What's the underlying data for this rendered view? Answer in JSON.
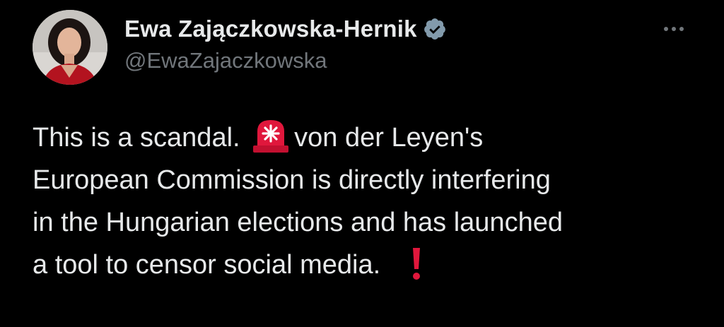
{
  "author": {
    "display_name": "Ewa Zajączkowska-Hernik",
    "handle": "@EwaZajaczkowska",
    "verified": true,
    "avatar_icon": "profile-photo-woman"
  },
  "tweet": {
    "lines": [
      {
        "before": "This is a scandal. ",
        "emoji": "siren-icon",
        "after": "von der Leyen's"
      },
      {
        "text": "European Commission is directly interfering"
      },
      {
        "text": "in the Hungarian elections and has launched"
      },
      {
        "before": "a tool to censor social media. ",
        "emoji": "red-exclamation-icon"
      }
    ]
  },
  "colors": {
    "background": "#000000",
    "text": "#e7e9ea",
    "secondary": "#71767b",
    "verified_badge": "#829aab",
    "siren_red": "#e0173c"
  },
  "icons": {
    "more": "more-dots-icon",
    "verified": "verified-badge-icon"
  }
}
